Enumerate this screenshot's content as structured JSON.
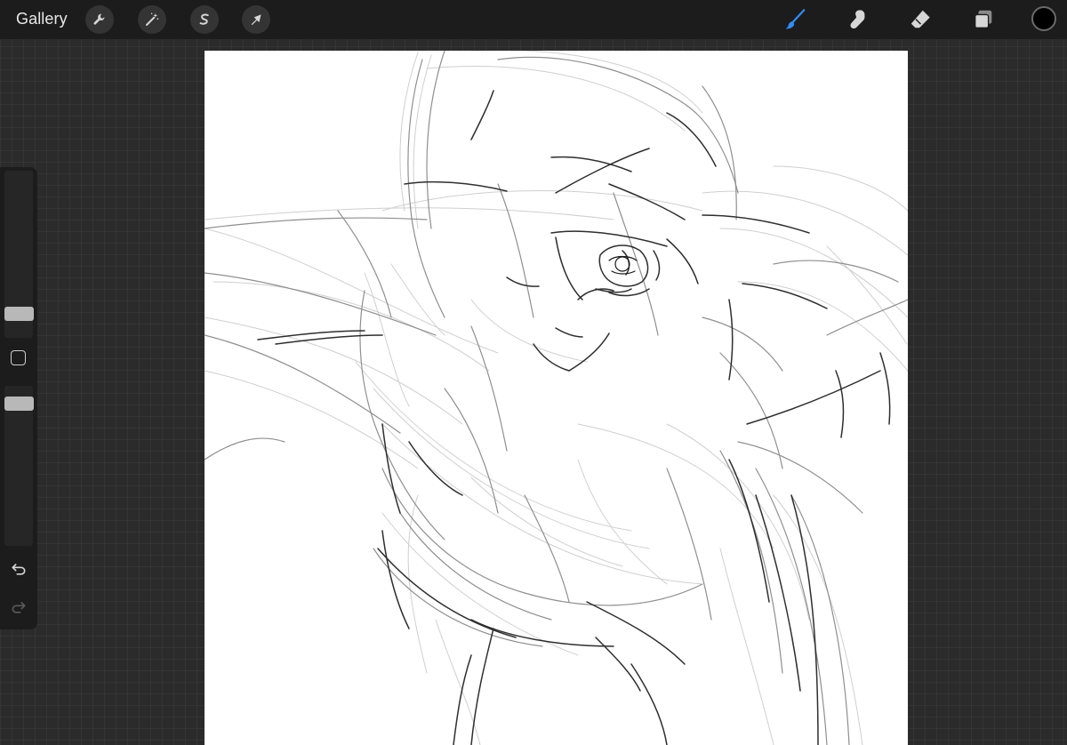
{
  "topbar": {
    "gallery_label": "Gallery",
    "left_tools": [
      {
        "name": "actions",
        "icon": "wrench-icon"
      },
      {
        "name": "adjustments",
        "icon": "magic-wand-icon"
      },
      {
        "name": "selection",
        "icon": "selection-s-icon"
      },
      {
        "name": "transform",
        "icon": "arrow-cursor-icon"
      }
    ],
    "right_tools": [
      {
        "name": "brush",
        "icon": "brush-icon",
        "active": true
      },
      {
        "name": "smudge",
        "icon": "smudge-finger-icon",
        "active": false
      },
      {
        "name": "eraser",
        "icon": "eraser-icon",
        "active": false
      },
      {
        "name": "layers",
        "icon": "layers-icon",
        "active": false
      }
    ],
    "current_color": "#000000"
  },
  "sidebar": {
    "brush_size_slider": {
      "icon": "brush-size-slider"
    },
    "modify_button": {
      "icon": "square-outline-icon"
    },
    "opacity_slider": {
      "icon": "opacity-slider"
    },
    "undo": {
      "icon": "undo-arrow-icon",
      "enabled": true
    },
    "redo": {
      "icon": "redo-arrow-icon",
      "enabled": false
    }
  },
  "colors": {
    "toolbar_bg": "#1c1c1c",
    "workspace_bg": "#2b2b2b",
    "active_tool": "#2f8df5",
    "icon_light": "#d6d6d6",
    "canvas_bg": "#ffffff"
  }
}
